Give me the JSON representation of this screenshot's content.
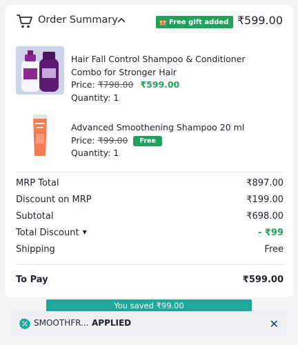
{
  "header": {
    "title": "Order Summary",
    "gift_badge": "Free gift added",
    "total": "₹599.00"
  },
  "items": [
    {
      "name_line1": "Hair Fall Control Shampoo & Conditioner",
      "name_line2": "Combo for Stronger Hair",
      "price_label": "Price:",
      "mrp": "₹798.00",
      "price": "₹599.00",
      "quantity": "Quantity: 1"
    },
    {
      "name_line1": "Advanced Smoothening Shampoo 20 ml",
      "price_label": "Price:",
      "mrp": "₹99.00",
      "badge": "Free",
      "quantity": "Quantity: 1"
    }
  ],
  "summary": [
    {
      "label": "MRP Total",
      "value": "₹897.00"
    },
    {
      "label": "Discount on MRP",
      "value": "₹199.00"
    },
    {
      "label": "Subtotal",
      "value": "₹698.00"
    },
    {
      "label": "Total Discount",
      "value": "- ₹99"
    },
    {
      "label": "Shipping",
      "value": "Free"
    }
  ],
  "to_pay": {
    "label": "To Pay",
    "value": "₹599.00"
  },
  "savings_banner": "You saved ₹99.00",
  "coupon": {
    "code": "SMOOTHFR...",
    "status": "APPLIED"
  },
  "colors": {
    "accent_green": "#21a05b",
    "teal": "#1fa79a",
    "close_icon": "#1f3f66"
  },
  "icons": [
    "cart-icon",
    "chevron-up-icon",
    "gift-icon",
    "coupon-percent-icon",
    "close-icon",
    "caret-down-icon"
  ]
}
